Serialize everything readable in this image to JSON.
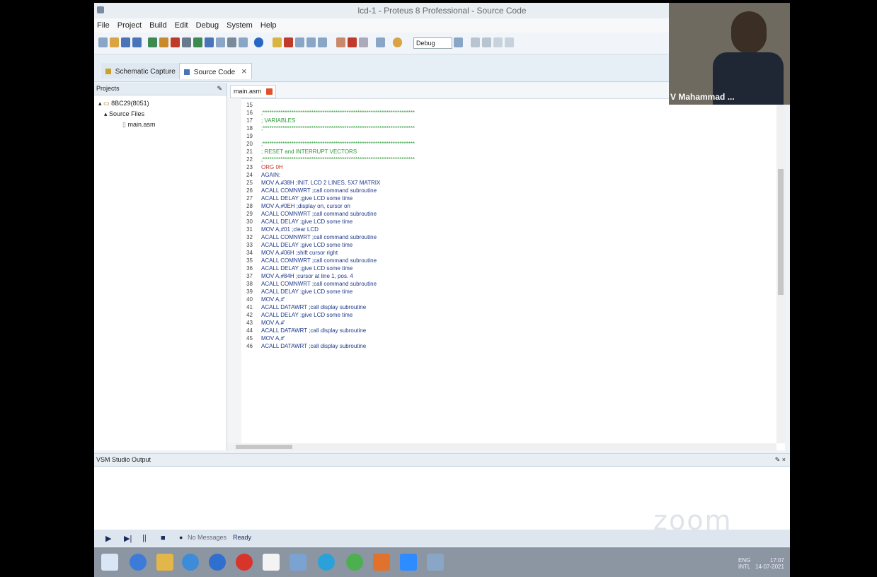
{
  "window": {
    "title": "lcd-1 - Proteus 8 Professional - Source Code"
  },
  "menu": [
    "File",
    "Project",
    "Build",
    "Edit",
    "Debug",
    "System",
    "Help"
  ],
  "toolbar": {
    "debug_select": "Debug"
  },
  "tabs": [
    {
      "label": "Schematic Capture"
    },
    {
      "label": "Source Code"
    }
  ],
  "projects": {
    "title": "Projects",
    "items": [
      {
        "label": "8BC29(8051)"
      },
      {
        "label": "Source Files"
      },
      {
        "label": "main.asm"
      }
    ]
  },
  "editor": {
    "file_tab": "main.asm",
    "lines": [
      {
        "n": "15",
        "text": "",
        "kind": "code"
      },
      {
        "n": "16",
        "text": ";*********************************************************************",
        "kind": "comment"
      },
      {
        "n": "17",
        "text": "; VARIABLES",
        "kind": "comment"
      },
      {
        "n": "18",
        "text": ";*********************************************************************",
        "kind": "comment"
      },
      {
        "n": "19",
        "text": "",
        "kind": "code"
      },
      {
        "n": "20",
        "text": ";*********************************************************************",
        "kind": "comment"
      },
      {
        "n": "21",
        "text": "; RESET and INTERRUPT VECTORS",
        "kind": "comment"
      },
      {
        "n": "22",
        "text": ";*********************************************************************",
        "kind": "comment"
      },
      {
        "n": "23",
        "text": "ORG 0H",
        "kind": "org"
      },
      {
        "n": "24",
        "text": "AGAIN:",
        "kind": "code"
      },
      {
        "n": "25",
        "text": "MOV A,#38H ;INIT. LCD 2 LINES, 5X7 MATRIX",
        "kind": "code"
      },
      {
        "n": "26",
        "text": "ACALL COMNWRT ;call command subroutine",
        "kind": "code"
      },
      {
        "n": "27",
        "text": "ACALL DELAY ;give LCD some time",
        "kind": "code"
      },
      {
        "n": "28",
        "text": "MOV A,#0EH ;display on, cursor on",
        "kind": "code"
      },
      {
        "n": "29",
        "text": "ACALL COMNWRT ;call command subroutine",
        "kind": "code"
      },
      {
        "n": "30",
        "text": "ACALL DELAY ;give LCD some time",
        "kind": "code"
      },
      {
        "n": "31",
        "text": "MOV A,#01 ;clear LCD",
        "kind": "code"
      },
      {
        "n": "32",
        "text": "ACALL COMNWRT ;call command subroutine",
        "kind": "code"
      },
      {
        "n": "33",
        "text": "ACALL DELAY ;give LCD some time",
        "kind": "code"
      },
      {
        "n": "34",
        "text": "MOV A,#06H ;shift cursor right",
        "kind": "code"
      },
      {
        "n": "35",
        "text": "ACALL COMNWRT ;call command subroutine",
        "kind": "code"
      },
      {
        "n": "36",
        "text": "ACALL DELAY ;give LCD some time",
        "kind": "code"
      },
      {
        "n": "37",
        "text": "MOV A,#84H ;cursor at line 1, pos. 4",
        "kind": "code"
      },
      {
        "n": "38",
        "text": "ACALL COMNWRT ;call command subroutine",
        "kind": "code"
      },
      {
        "n": "39",
        "text": "ACALL DELAY ;give LCD some time",
        "kind": "code"
      },
      {
        "n": "40",
        "text": "MOV A,#'",
        "kind": "code"
      },
      {
        "n": "41",
        "text": "ACALL DATAWRT ;call display subroutine",
        "kind": "code"
      },
      {
        "n": "42",
        "text": "ACALL DELAY ;give LCD some time",
        "kind": "code"
      },
      {
        "n": "43",
        "text": "MOV A,#'",
        "kind": "code"
      },
      {
        "n": "44",
        "text": "ACALL DATAWRT ;call display subroutine",
        "kind": "code"
      },
      {
        "n": "45",
        "text": "MOV A,#'",
        "kind": "code"
      },
      {
        "n": "46",
        "text": "ACALL DATAWRT ;call display subroutine",
        "kind": "code"
      }
    ]
  },
  "output": {
    "title": "VSM Studio Output",
    "watermark": "zoom"
  },
  "status": {
    "messages": "No Messages",
    "state": "Ready"
  },
  "tray": {
    "lang1": "ENG",
    "lang2": "INTL",
    "time": "17:07",
    "date": "14-07-2021"
  },
  "video": {
    "participant": "V Mahammad ..."
  },
  "colors": {
    "comment": "#2f9a3a",
    "code": "#203a8a",
    "org": "#c0392b",
    "zoom_tile": "#4a4640"
  }
}
